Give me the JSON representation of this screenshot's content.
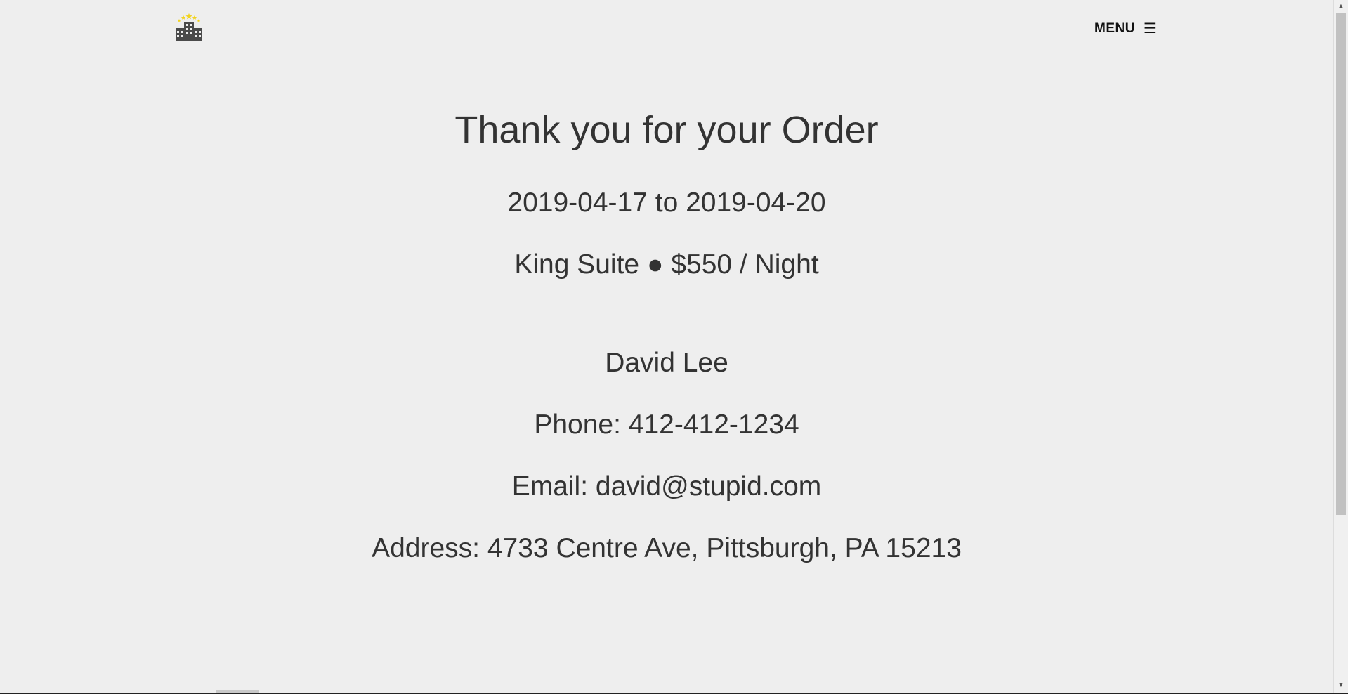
{
  "header": {
    "menu_label": "MENU",
    "menu_icon": "hamburger-icon",
    "logo_icon": "hotel-building-icon",
    "logo_star_color": "#f2d31b",
    "logo_building_color": "#4a4a4a"
  },
  "order": {
    "title": "Thank you for your Order",
    "dates": "2019-04-17 to 2019-04-20",
    "room": "King Suite ● $550 / Night",
    "name": "David Lee",
    "phone": "Phone: 412-412-1234",
    "email": "Email: david@stupid.com",
    "address": "Address: 4733 Centre Ave, Pittsburgh, PA 15213"
  },
  "colors": {
    "background": "#eeeeee",
    "text": "#333333"
  }
}
